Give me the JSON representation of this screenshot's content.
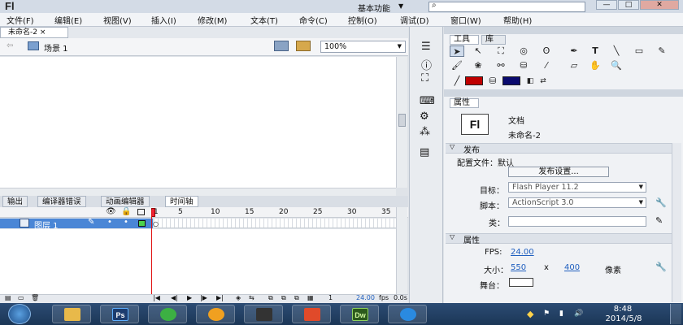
{
  "app": {
    "logo": "Fl",
    "workspace": "基本功能",
    "search_placeholder": "",
    "win_buttons": [
      "—",
      "□",
      "✕"
    ]
  },
  "menu": [
    "文件(F)",
    "编辑(E)",
    "视图(V)",
    "插入(I)",
    "修改(M)",
    "文本(T)",
    "命令(C)",
    "控制(O)",
    "调试(D)",
    "窗口(W)",
    "帮助(H)"
  ],
  "document": {
    "tab": "未命名-2",
    "close": "×",
    "scene": "场景 1",
    "zoom": "100%"
  },
  "bottom_tabs": [
    "输出",
    "编译器错误",
    "动画编辑器",
    "时间轴"
  ],
  "timeline": {
    "frame_numbers": [
      "1",
      "5",
      "10",
      "15",
      "20",
      "25",
      "30",
      "35"
    ],
    "layer_name": "图层 1",
    "current_frame": "1",
    "fps": "24.00",
    "fps_unit": "fps",
    "time": "0.0s"
  },
  "tool_panel": {
    "tabs": [
      "工具",
      "库"
    ]
  },
  "properties": {
    "tab": "属性",
    "type": "文档",
    "doc_name": "未命名-2",
    "doc_icon": "Fl",
    "publish_section": "发布",
    "profile_label": "配置文件：默认",
    "publish_settings_btn": "发布设置...",
    "target_label": "目标：",
    "target_value": "Flash Player 11.2",
    "script_label": "脚本：",
    "script_value": "ActionScript 3.0",
    "class_label": "类：",
    "props_section": "属性",
    "fps_label": "FPS:",
    "fps_value": "24.00",
    "size_label": "大小：",
    "width": "550",
    "times": "x",
    "height": "400",
    "unit": "像素",
    "stage_label": "舞台："
  },
  "taskbar": {
    "apps": [
      "Ps",
      "Dw"
    ],
    "time": "8:48",
    "date": "2014/5/8"
  },
  "colors": {
    "stroke": "#c00000",
    "fill": "#0a0a6e",
    "accent": "#4a86d6",
    "playhead": "#e01010"
  }
}
